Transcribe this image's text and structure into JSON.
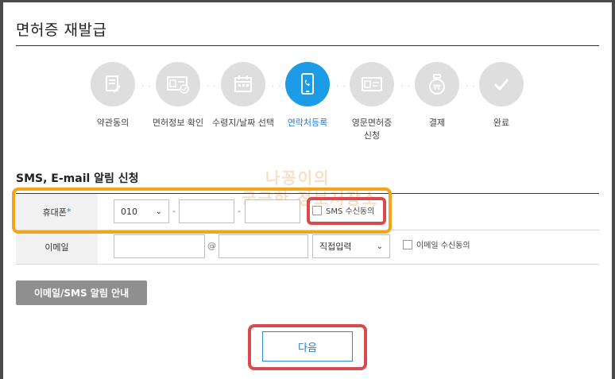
{
  "page": {
    "title": "면허증 재발급"
  },
  "steps": [
    {
      "label": "약관동의",
      "icon": "document-edit-icon",
      "active": false
    },
    {
      "label": "면허정보 확인",
      "icon": "id-card-check-icon",
      "active": false
    },
    {
      "label": "수령지/날짜 선택",
      "icon": "calendar-icon",
      "active": false
    },
    {
      "label": "연락처등록",
      "icon": "smartphone-icon",
      "active": true
    },
    {
      "label": "영문면허증\n신청",
      "icon": "id-card-icon",
      "active": false
    },
    {
      "label": "결제",
      "icon": "money-bag-icon",
      "active": false
    },
    {
      "label": "완료",
      "icon": "checkmark-icon",
      "active": false
    }
  ],
  "section": {
    "title": "SMS, E-mail 알림 신청"
  },
  "phone": {
    "label": "휴대폰",
    "required_mark": "*",
    "prefix_value": "010",
    "separator": "-",
    "middle_value": "",
    "last_value": "",
    "sms_consent_label": "SMS 수신동의"
  },
  "email": {
    "label": "이메일",
    "local_value": "",
    "at": "@",
    "domain_value": "",
    "domain_select": "직접입력",
    "consent_label": "이메일 수신동의"
  },
  "buttons": {
    "notice": "이메일/SMS 알림 안내",
    "next": "다음"
  },
  "watermark": {
    "line1": "나꽁이의",
    "line2": "궁금한 정보저장소"
  },
  "colors": {
    "accent": "#1c9be6",
    "highlight_orange": "#f4a418",
    "highlight_red": "#d94a4f",
    "step_inactive": "#dedede"
  }
}
